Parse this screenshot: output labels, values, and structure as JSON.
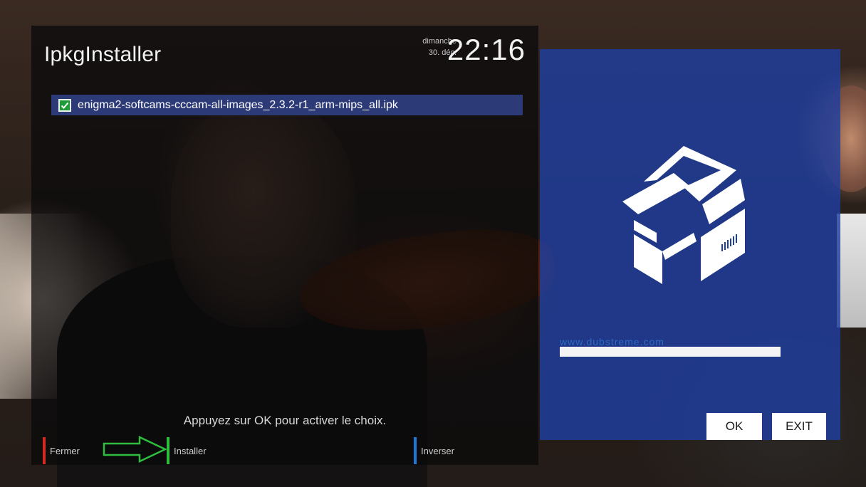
{
  "app": {
    "title": "IpkgInstaller"
  },
  "clock": {
    "day": "dimanche",
    "date": "30. déc.",
    "time": "22:16"
  },
  "file_list": [
    {
      "name": "enigma2-softcams-cccam-all-images_2.3.2-r1_arm-mips_all.ipk",
      "checked": true
    }
  ],
  "hint": "Appuyez sur OK pour activer le choix.",
  "function_keys": {
    "red": "Fermer",
    "green": "Installer",
    "blue": "Inverser"
  },
  "side_panel": {
    "watermark": "www.dubstreme.com",
    "ok_label": "OK",
    "exit_label": "EXIT",
    "icon": "package-box-icon"
  },
  "colors": {
    "red_key": "#d52a24",
    "green_key": "#2fbd3e",
    "blue_key": "#1e78d8",
    "selection": "#2d3a78",
    "side_panel": "#1e3ea0",
    "annotation_arrow": "#2fbd3e"
  }
}
